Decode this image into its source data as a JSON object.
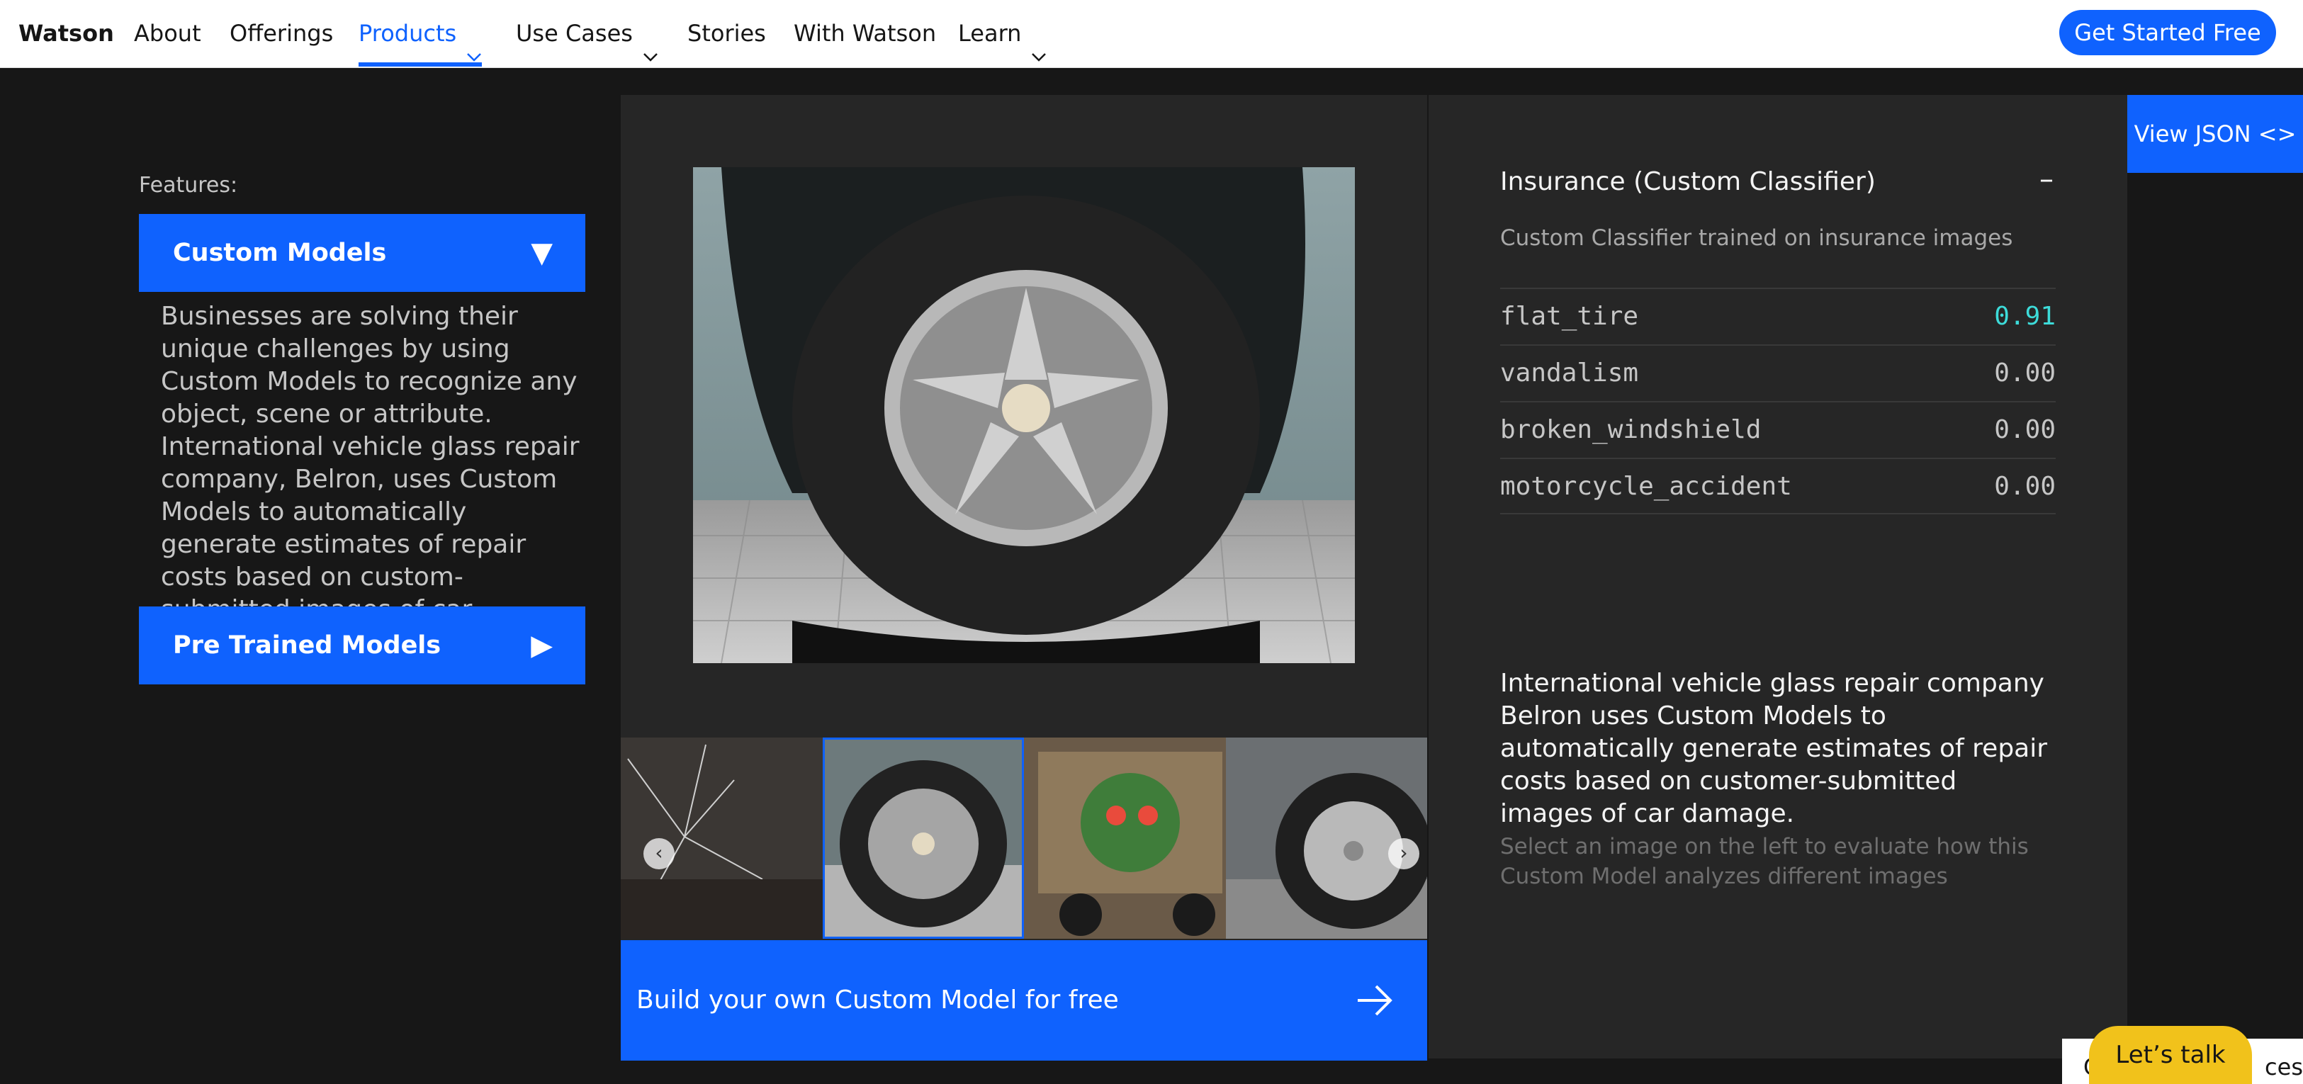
{
  "nav": {
    "brand": "Watson",
    "items": [
      {
        "label": "About"
      },
      {
        "label": "Offerings"
      },
      {
        "label": "Products",
        "active": true,
        "has_dropdown": true
      },
      {
        "label": "Use Cases",
        "has_dropdown": true
      },
      {
        "label": "Stories"
      },
      {
        "label": "With Watson"
      },
      {
        "label": "Learn",
        "has_dropdown": true
      }
    ],
    "cta_label": "Get Started Free"
  },
  "features": {
    "label": "Features:",
    "items": [
      {
        "label": "Custom Models",
        "expanded": true,
        "icon": "triangle-down-icon",
        "description": "Businesses are solving their unique challenges by using Custom Models to recognize any object, scene or attribute. International vehicle glass repair company, Belron, uses Custom Models to automatically generate estimates of repair costs based on custom-submitted images of car damage."
      },
      {
        "label": "Pre Trained Models",
        "expanded": false,
        "icon": "triangle-right-icon"
      }
    ]
  },
  "demo": {
    "thumbnails": [
      {
        "subject": "broken windshield"
      },
      {
        "subject": "flat tire",
        "selected": true
      },
      {
        "subject": "vandalism graffiti"
      },
      {
        "subject": "car wheel"
      }
    ],
    "build_label": "Build your own Custom Model for free"
  },
  "classifier": {
    "title": "Insurance (Custom Classifier)",
    "collapse_symbol": "–",
    "subtitle": "Custom Classifier trained on insurance images",
    "scores": [
      {
        "class": "flat_tire",
        "score": "0.91",
        "highlight": true
      },
      {
        "class": "vandalism",
        "score": "0.00"
      },
      {
        "class": "broken_windshield",
        "score": "0.00"
      },
      {
        "class": "motorcycle_accident",
        "score": "0.00"
      }
    ],
    "description": "International vehicle glass repair company Belron uses Custom Models to automatically generate estimates of repair costs based on customer-submitted images of car damage.",
    "hint": "Select an image on the left to evaluate how this Custom Model analyzes different images"
  },
  "view_json_label": "View JSON <>",
  "cookie_bar": {
    "left": "C",
    "right": "ces"
  },
  "chat_label": "Let’s talk",
  "colors": {
    "accent": "#0f62fe",
    "score_highlight": "#3ddbd9",
    "chat": "#f1c21b"
  }
}
